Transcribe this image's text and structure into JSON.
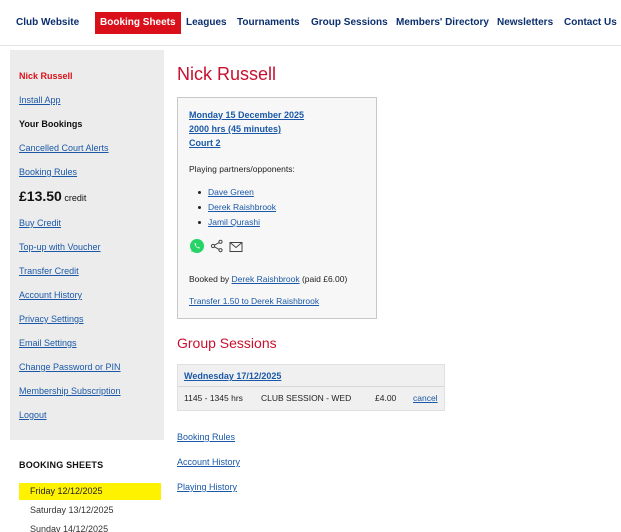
{
  "topnav": {
    "items": [
      {
        "label": "Club Website"
      },
      {
        "label": "Booking Sheets"
      },
      {
        "label": "Leagues"
      },
      {
        "label": "Tournaments"
      },
      {
        "label": "Group Sessions"
      },
      {
        "label": "Members' Directory"
      },
      {
        "label": "Newsletters"
      },
      {
        "label": "Contact Us"
      }
    ]
  },
  "sidebar": {
    "user_name": "Nick Russell",
    "install_app": "Install App",
    "your_bookings": "Your Bookings",
    "cancelled_court_alerts": "Cancelled Court Alerts",
    "booking_rules": "Booking Rules",
    "credit_amount": "£13.50",
    "credit_label": "credit",
    "buy_credit": "Buy Credit",
    "topup_voucher": "Top-up with Voucher",
    "transfer_credit": "Transfer Credit",
    "account_history": "Account History",
    "privacy_settings": "Privacy Settings",
    "email_settings": "Email Settings",
    "change_password": "Change Password or PIN",
    "membership_subscription": "Membership Subscription",
    "logout": "Logout"
  },
  "booking_sheets": {
    "title": "BOOKING SHEETS",
    "days": [
      {
        "label": "Friday 12/12/2025"
      },
      {
        "label": "Saturday 13/12/2025"
      },
      {
        "label": "Sunday 14/12/2025"
      }
    ]
  },
  "main": {
    "page_title": "Nick Russell",
    "booking": {
      "date": "Monday 15 December 2025",
      "time": "2000 hrs (45 minutes)",
      "court": "Court 2",
      "partners_label": "Playing partners/opponents:",
      "partners": [
        {
          "name": "Dave Green"
        },
        {
          "name": "Derek Raishbrook"
        },
        {
          "name": "Jamil Qurashi"
        }
      ],
      "booked_by_prefix": "Booked by",
      "booked_by_name": "Derek Raishbrook",
      "booked_by_paid": "(paid £6.00)",
      "transfer_link": "Transfer 1.50 to Derek Raishbrook"
    },
    "group_sessions": {
      "title": "Group Sessions",
      "date": "Wednesday 17/12/2025",
      "time": "1145 - 1345 hrs",
      "session": "CLUB SESSION - WED",
      "price": "£4.00",
      "cancel": "cancel"
    },
    "bottom_links": {
      "booking_rules": "Booking Rules",
      "account_history": "Account History",
      "playing_history": "Playing History"
    }
  },
  "colors": {
    "brand_red": "#d9101a",
    "nav_blue": "#0b2f6f",
    "link_blue": "#1b59a8",
    "whatsapp_green": "#25d366",
    "today_highlight": "#fff200"
  },
  "icons": {
    "whatsapp": "whatsapp-icon",
    "share": "share-icon",
    "email": "email-icon"
  }
}
